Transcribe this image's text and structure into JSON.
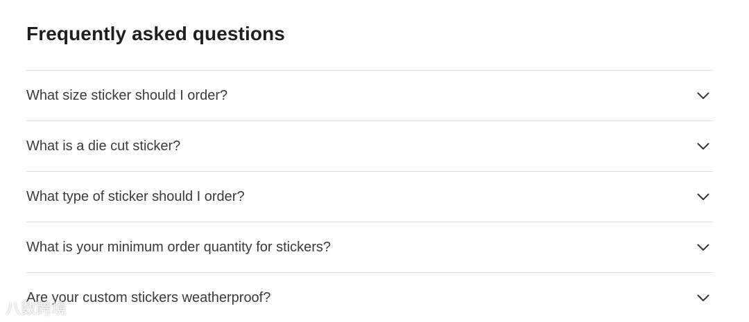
{
  "faq": {
    "title": "Frequently asked questions",
    "items": [
      {
        "question": "What size sticker should I order?",
        "icon": "chevron-down-icon"
      },
      {
        "question": "What is a die cut sticker?",
        "icon": "chevron-down-icon"
      },
      {
        "question": "What type of sticker should I order?",
        "icon": "chevron-down-icon"
      },
      {
        "question": "What is your minimum order quantity for stickers?",
        "icon": "chevron-down-icon"
      },
      {
        "question": "Are your custom stickers weatherproof?",
        "icon": "chevron-down-icon"
      }
    ]
  },
  "watermark": {
    "text": "八数跨境"
  },
  "colors": {
    "text": "#3a3a3a",
    "heading": "#1f1f1f",
    "divider": "#dcdcdc",
    "background": "#ffffff"
  }
}
